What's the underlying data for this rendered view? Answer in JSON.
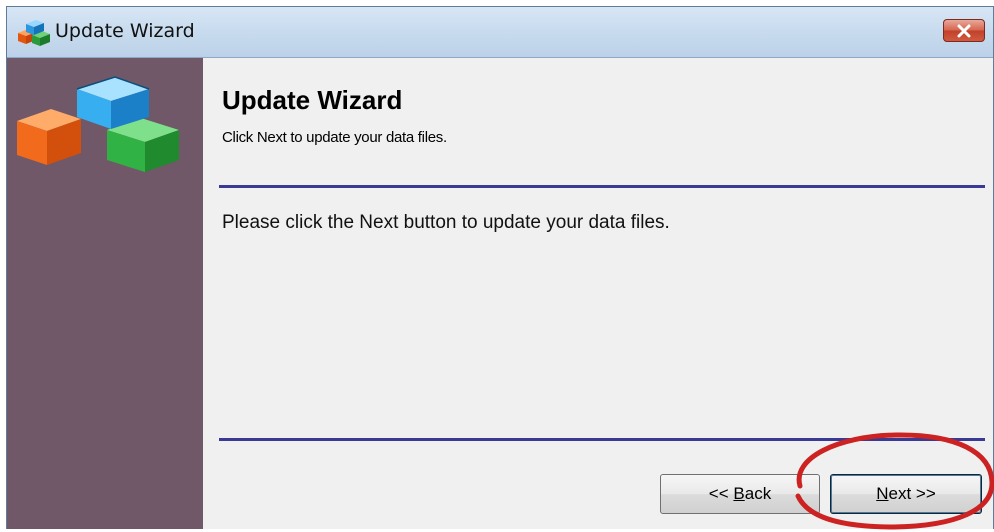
{
  "window": {
    "title": "Update Wizard",
    "title_icon": "colored-blocks-icon",
    "close_icon": "close-icon"
  },
  "sidebar": {
    "logo": "colored-blocks-logo"
  },
  "main": {
    "heading": "Update Wizard",
    "subheading": "Click Next to update your data files.",
    "body": "Please click the Next button to update your data files."
  },
  "buttons": {
    "back": {
      "prefix": "<< ",
      "mnemonic": "B",
      "rest": "ack"
    },
    "next": {
      "mnemonic": "N",
      "rest": "ext >>"
    }
  },
  "colors": {
    "sidebar": "#705868",
    "divider": "#3a3a94",
    "annotation": "#cc2222",
    "block_orange": "#f26a1b",
    "block_blue": "#2aa3e6",
    "block_green": "#27a33a"
  }
}
